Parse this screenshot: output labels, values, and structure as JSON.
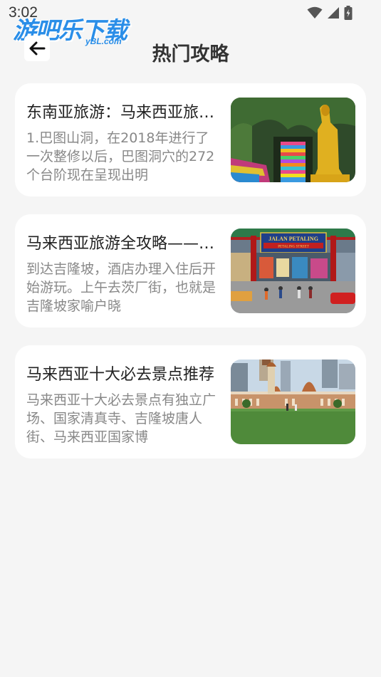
{
  "status_bar": {
    "time": "3:02"
  },
  "watermark": {
    "name": "游吧乐下载",
    "domain": "yBL.com"
  },
  "header": {
    "title": "热门攻略"
  },
  "cards": [
    {
      "title": "东南亚旅游：马来西亚旅游攻略",
      "description": "1.巴图山洞，在2018年进行了一次整修以后，巴图洞穴的272个台阶现在呈现出明",
      "image_icon": "batu-caves-photo"
    },
    {
      "title": "马来西亚旅游全攻略——吉隆坡",
      "description": "到达吉隆坡，酒店办理入住后开始游玩。上午去茨厂街，也就是吉隆坡家喻户晓",
      "image_icon": "petaling-street-photo",
      "image_sign": {
        "line1": "JALAN PETALING",
        "line2": "PETALING STREET"
      }
    },
    {
      "title": "马来西亚十大必去景点推荐",
      "description": "马来西亚十大必去景点有独立广场、国家清真寺、吉隆坡唐人街、马来西亚国家博",
      "image_icon": "merdeka-square-photo"
    }
  ]
}
